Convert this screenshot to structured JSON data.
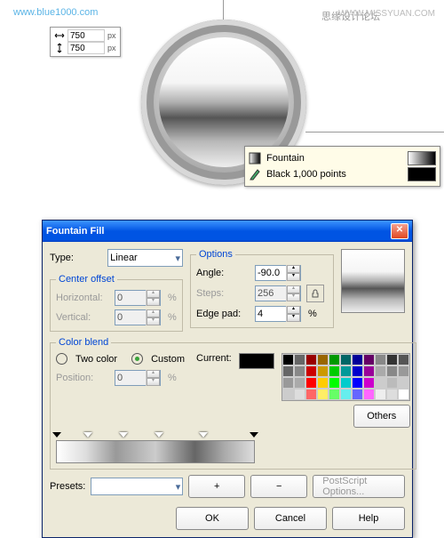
{
  "watermarks": {
    "left": "www.blue1000.com",
    "right1": "思缘设计论坛",
    "right2": "WWW.MISSYUAN.COM"
  },
  "size": {
    "w": "750",
    "h": "750",
    "unit": "px"
  },
  "tooltip": {
    "line1": "Fountain",
    "line2": "Black  1,000 points"
  },
  "dialog": {
    "title": "Fountain Fill",
    "type_label": "Type:",
    "type_value": "Linear",
    "center_offset": "Center offset",
    "horizontal": "Horizontal:",
    "horizontal_val": "0",
    "vertical": "Vertical:",
    "vertical_val": "0",
    "options": "Options",
    "angle": "Angle:",
    "angle_val": "-90.0",
    "steps": "Steps:",
    "steps_val": "256",
    "edgepad": "Edge pad:",
    "edgepad_val": "4",
    "colorblend": "Color blend",
    "twocolor": "Two color",
    "custom": "Custom",
    "position": "Position:",
    "position_val": "0",
    "current": "Current:",
    "others": "Others",
    "presets": "Presets:",
    "postscript": "PostScript Options...",
    "ok": "OK",
    "cancel": "Cancel",
    "help": "Help",
    "pct": "%"
  },
  "palette_colors": [
    "#000",
    "#666",
    "#900",
    "#960",
    "#090",
    "#066",
    "#009",
    "#606",
    "#888",
    "#333",
    "#555",
    "#666",
    "#888",
    "#c00",
    "#c90",
    "#0c0",
    "#099",
    "#00c",
    "#909",
    "#aaa",
    "#888",
    "#999",
    "#999",
    "#aaa",
    "#f00",
    "#fc0",
    "#0f0",
    "#0cc",
    "#00f",
    "#c0c",
    "#ccc",
    "#bbb",
    "#ccc",
    "#ccc",
    "#ddd",
    "#f66",
    "#fe6",
    "#6f6",
    "#6ee",
    "#66f",
    "#f6f",
    "#eee",
    "#ddd",
    "#fff"
  ]
}
